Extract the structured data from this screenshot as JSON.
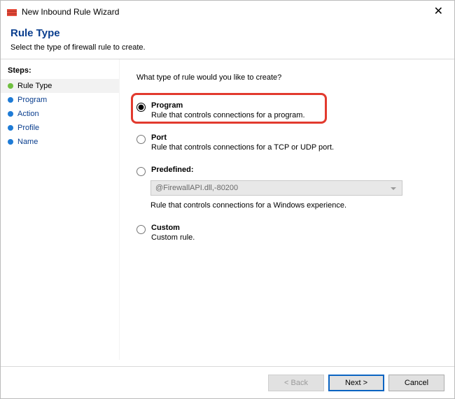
{
  "titlebar": {
    "title": "New Inbound Rule Wizard"
  },
  "header": {
    "title": "Rule Type",
    "subtitle": "Select the type of firewall rule to create."
  },
  "sidebar": {
    "title": "Steps:",
    "items": [
      {
        "label": "Rule Type"
      },
      {
        "label": "Program"
      },
      {
        "label": "Action"
      },
      {
        "label": "Profile"
      },
      {
        "label": "Name"
      }
    ]
  },
  "main": {
    "prompt": "What type of rule would you like to create?",
    "options": {
      "program": {
        "name": "Program",
        "desc": "Rule that controls connections for a program."
      },
      "port": {
        "name": "Port",
        "desc": "Rule that controls connections for a TCP or UDP port."
      },
      "predefined": {
        "name": "Predefined:",
        "select_value": "@FirewallAPI.dll,-80200",
        "desc": "Rule that controls connections for a Windows experience."
      },
      "custom": {
        "name": "Custom",
        "desc": "Custom rule."
      }
    }
  },
  "footer": {
    "back": "< Back",
    "next": "Next >",
    "cancel": "Cancel"
  }
}
